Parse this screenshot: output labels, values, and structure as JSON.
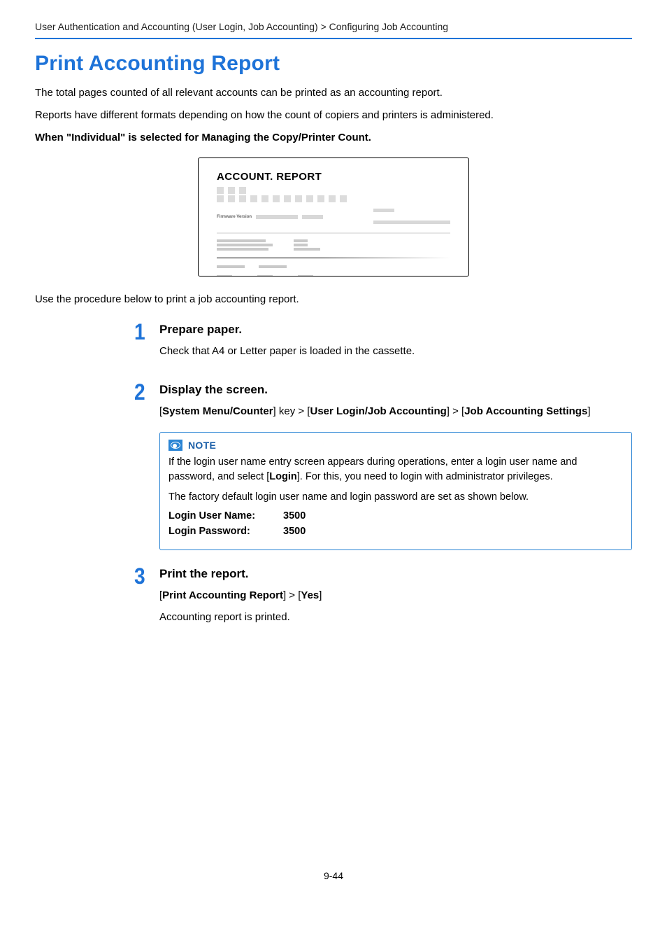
{
  "breadcrumb": {
    "text": "User Authentication and Accounting (User Login, Job Accounting) > Configuring Job Accounting"
  },
  "titles": {
    "main": "Print Accounting Report",
    "step1": "Prepare paper.",
    "step2": "Display the screen.",
    "step3": "Print the report."
  },
  "body": {
    "intro1": "The total pages counted of all relevant accounts can be printed as an accounting report.",
    "intro2": "Reports have different formats depending on how the count of copiers and printers is administered.",
    "condition": "When \"Individual\" is selected for Managing the Copy/Printer Count.",
    "procedure_intro": "Use the procedure below to print a job accounting report.",
    "step1_text": "Check that A4 or Letter paper is loaded in the cassette.",
    "step3_trail": "Accounting report is printed."
  },
  "step2_path": {
    "prefix": "[",
    "p1": "System Menu/Counter",
    "mid1": "] key > [",
    "p2": "User Login/Job Accounting",
    "mid2": "] > [",
    "p3": "Job Accounting Settings",
    "suffix": "]"
  },
  "step3_path": {
    "prefix": "[",
    "p1": "Print Accounting Report",
    "mid1": "] > [",
    "p2": "Yes",
    "suffix": "]"
  },
  "note": {
    "label": "NOTE",
    "line1a": "If the login user name entry screen appears during operations, enter a login user name and password, and select [",
    "login_bold": "Login",
    "line1b": "]. For this, you need to login with administrator privileges.",
    "line2": "The factory default login user name and login password are set as shown below.",
    "user_label": "Login User Name:",
    "user_value": "3500",
    "pass_label": "Login Password:",
    "pass_value": "3500"
  },
  "preview": {
    "title": "ACCOUNT. REPORT",
    "fw_label": "Firmware Version"
  },
  "nums": {
    "s1": "1",
    "s2": "2",
    "s3": "3"
  },
  "page_number": "9-44"
}
